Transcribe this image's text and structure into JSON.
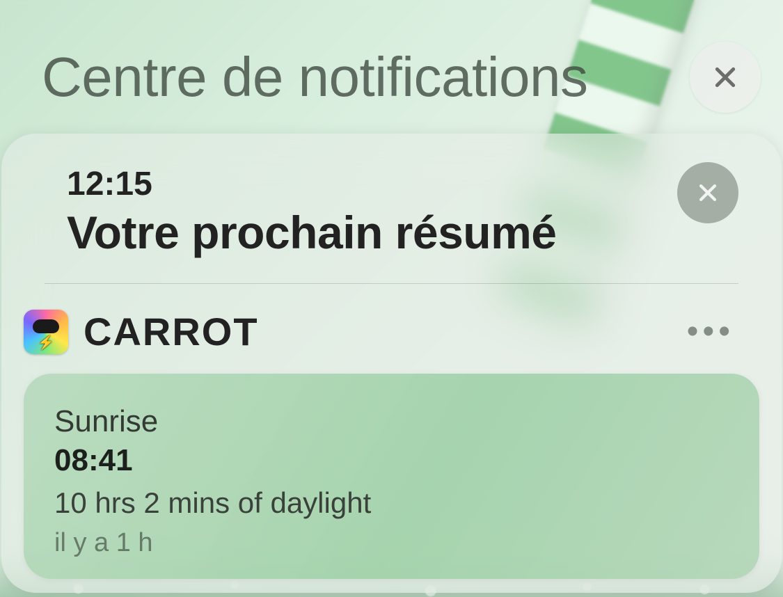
{
  "header": {
    "title": "Centre de notifications"
  },
  "summary": {
    "time": "12:15",
    "title": "Votre prochain résumé"
  },
  "app": {
    "name": "CARROT"
  },
  "notification": {
    "title": "Sunrise",
    "time": "08:41",
    "body": "10 hrs 2 mins of daylight",
    "ago": "il y a 1 h"
  }
}
